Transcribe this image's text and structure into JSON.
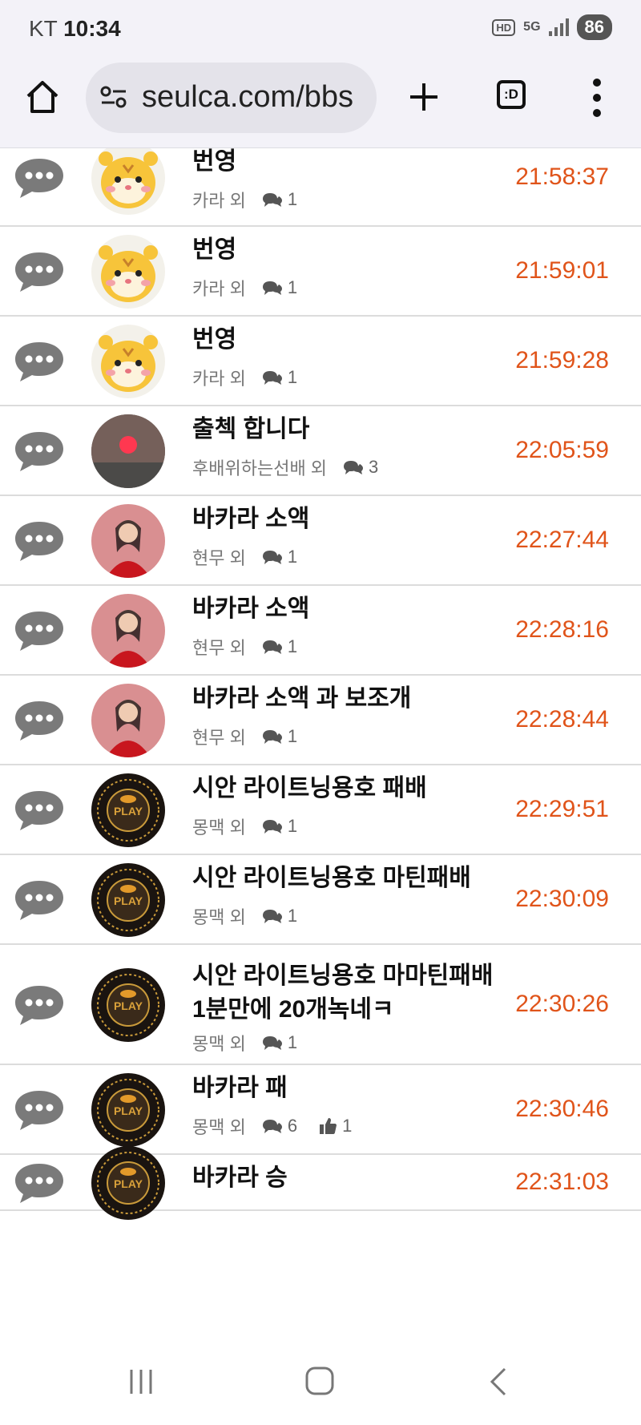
{
  "status_bar": {
    "carrier": "KT",
    "time": "10:34",
    "hd_label": "HD",
    "network": "5G",
    "battery": "86"
  },
  "browser": {
    "url": "seulca.com/bbs",
    "tabs_label": ":D",
    "icons": [
      "home-icon",
      "site-settings-icon",
      "new-tab-icon",
      "tabs-icon",
      "more-menu-icon"
    ]
  },
  "colors": {
    "time": "#e0541a",
    "chat_icon": "#7a7a7a"
  },
  "posts": [
    {
      "title": "번영",
      "author": "카라 외",
      "comments": "1",
      "likes": null,
      "time": "21:58:37",
      "avatar": "tiger"
    },
    {
      "title": "번영",
      "author": "카라 외",
      "comments": "1",
      "likes": null,
      "time": "21:59:01",
      "avatar": "tiger"
    },
    {
      "title": "번영",
      "author": "카라 외",
      "comments": "1",
      "likes": null,
      "time": "21:59:28",
      "avatar": "tiger"
    },
    {
      "title": "출첵 합니다",
      "author": "후배위하는선배 외",
      "comments": "3",
      "likes": null,
      "time": "22:05:59",
      "avatar": "sunset"
    },
    {
      "title": "바카라 소액",
      "author": "현무 외",
      "comments": "1",
      "likes": null,
      "time": "22:27:44",
      "avatar": "woman"
    },
    {
      "title": "바카라 소액",
      "author": "현무 외",
      "comments": "1",
      "likes": null,
      "time": "22:28:16",
      "avatar": "woman"
    },
    {
      "title": "바카라 소액 과 보조개",
      "author": "현무 외",
      "comments": "1",
      "likes": null,
      "time": "22:28:44",
      "avatar": "woman"
    },
    {
      "title": "시안 라이트닝용호 패배",
      "author": "몽맥 외",
      "comments": "1",
      "likes": null,
      "time": "22:29:51",
      "avatar": "play"
    },
    {
      "title": "시안 라이트닝용호 마틴패배",
      "author": "몽맥 외",
      "comments": "1",
      "likes": null,
      "time": "22:30:09",
      "avatar": "play"
    },
    {
      "title": "시안 라이트닝용호 마마틴패배 1분만에 20개녹네ㅋ",
      "author": "몽맥 외",
      "comments": "1",
      "likes": null,
      "time": "22:30:26",
      "avatar": "play"
    },
    {
      "title": "바카라 패",
      "author": "몽맥 외",
      "comments": "6",
      "likes": "1",
      "time": "22:30:46",
      "avatar": "play"
    },
    {
      "title": "바카라 승",
      "author": "",
      "comments": "",
      "likes": null,
      "time": "22:31:03",
      "avatar": "play"
    }
  ],
  "nav": {
    "icons": [
      "recent-apps-icon",
      "home-button-icon",
      "back-icon"
    ]
  }
}
